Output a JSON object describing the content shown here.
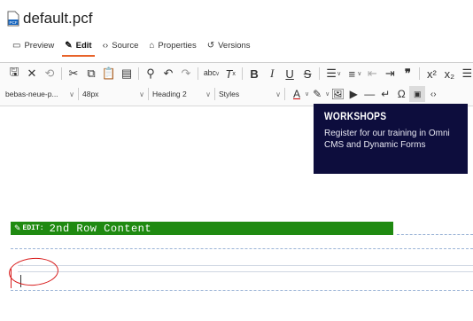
{
  "page": {
    "title": "default.pcf"
  },
  "tabs": [
    {
      "icon": "preview-icon",
      "glyph": "▭",
      "label": "Preview",
      "active": false
    },
    {
      "icon": "edit-pencil-icon",
      "glyph": "✎",
      "label": "Edit",
      "active": true
    },
    {
      "icon": "source-code-icon",
      "glyph": "‹›",
      "label": "Source",
      "active": false
    },
    {
      "icon": "properties-icon",
      "glyph": "⌂",
      "label": "Properties",
      "active": false
    },
    {
      "icon": "versions-icon",
      "glyph": "↺",
      "label": "Versions",
      "active": false
    }
  ],
  "toolbar": {
    "row2": {
      "font": "bebas-neue-p...",
      "size": "48px",
      "format": "Heading 2",
      "styles": "Styles"
    }
  },
  "card": {
    "title": "WORKSHOPS",
    "text": "Register for our training in Omni CMS and Dynamic Forms"
  },
  "row": {
    "edit_label": "EDIT:",
    "content": "2nd Row Content"
  },
  "colors": {
    "accent_tab": "#e8632a",
    "card_bg": "#0d0d3d",
    "row_bar": "#1f8a11",
    "annotation": "#d81c1c"
  }
}
